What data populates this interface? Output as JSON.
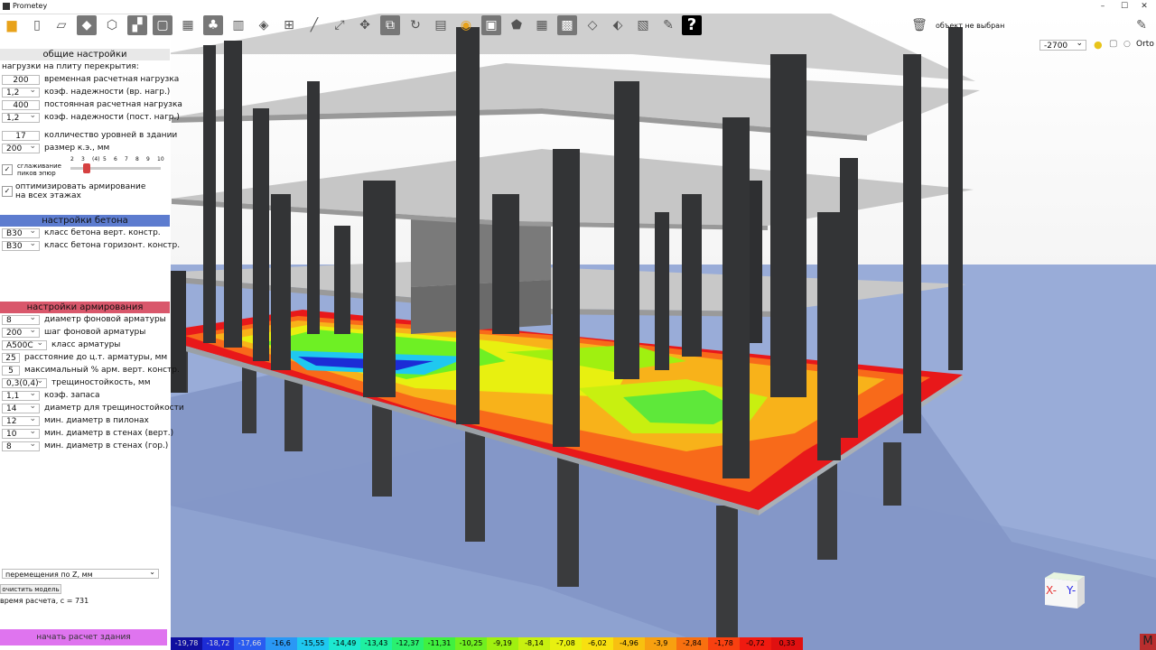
{
  "window": {
    "title": "Prometey",
    "minimize": "–",
    "maximize": "☐",
    "close": "✕"
  },
  "toolbar": {
    "help_label": "?",
    "object_status": "объект не выбран",
    "level_value": "-2700",
    "ortho_label": "Orto"
  },
  "general": {
    "header": "общие настройки",
    "loads_label": "нагрузки на плиту перекрытия:",
    "temp_load_value": "200",
    "temp_load_label": "временная расчетная нагрузка",
    "temp_coef_value": "1,2",
    "temp_coef_label": "коэф. надежности (вр. нагр.)",
    "perm_load_value": "400",
    "perm_load_label": "постоянная расчетная нагрузка",
    "perm_coef_value": "1,2",
    "perm_coef_label": "коэф. надежности (пост. нагр.)",
    "levels_value": "17",
    "levels_label": "колличество уровней в здании",
    "mesh_value": "200",
    "mesh_label": "размер к.э., мм",
    "smoothing_label_1": "сглаживание",
    "smoothing_label_2": "пиков эпюр",
    "slider_ticks": [
      "2",
      "3",
      "(4)",
      "5",
      "6",
      "7",
      "8",
      "9",
      "10"
    ],
    "smoothing_level": 0.18,
    "optimize_label_1": "оптимизировать армирование",
    "optimize_label_2": "на всех этажах"
  },
  "concrete": {
    "header": "настройки бетона",
    "vert_value": "B30",
    "vert_label": "класс бетона верт. констр.",
    "horiz_value": "B30",
    "horiz_label": "класс бетона горизонт. констр."
  },
  "reinforcement": {
    "header": "настройки армирования",
    "bg_dia_value": "8",
    "bg_dia_label": "диаметр фоновой арматуры",
    "bg_step_value": "200",
    "bg_step_label": "шаг фоновой арматуры",
    "class_value": "A500C",
    "class_label": "класс арматуры",
    "cover_value": "25",
    "cover_label": "расстояние до ц.т. арматуры, мм",
    "max_pct_value": "5",
    "max_pct_label": "максимальный % арм. верт. констр.",
    "crack_value": "0,3(0,4)",
    "crack_label": "трещиностойкость, мм",
    "reserve_value": "1,1",
    "reserve_label": "коэф. запаса",
    "crack_dia_value": "14",
    "crack_dia_label": "диаметр для трещиностойкости",
    "pylon_value": "12",
    "pylon_label": "мин. диаметр в пилонах",
    "wall_v_value": "10",
    "wall_v_label": "мин. диаметр в стенах (верт.)",
    "wall_h_value": "8",
    "wall_h_label": "мин. диаметр в стенах (гор.)"
  },
  "bottom": {
    "result_select": "перемещения по Z, мм",
    "clear_button": "очистить модель",
    "calc_time": "время расчета, с = 731",
    "start_button": "начать расчет здания"
  },
  "legend": {
    "values": [
      "-19,78",
      "-18,72",
      "-17,66",
      "-16,6",
      "-15,55",
      "-14,49",
      "-13,43",
      "-12,37",
      "-11,31",
      "-10,25",
      "-9,19",
      "-8,14",
      "-7,08",
      "-6,02",
      "-4,96",
      "-3,9",
      "-2,84",
      "-1,78",
      "-0,72",
      "0,33"
    ],
    "colors": [
      "#1010a0",
      "#1c2cd6",
      "#2a5cf0",
      "#2a98f5",
      "#1fc8f0",
      "#1de8d0",
      "#1ff0a0",
      "#2af070",
      "#40f040",
      "#70f020",
      "#a0f010",
      "#c8f010",
      "#e8f010",
      "#f8e010",
      "#f8c010",
      "#f8a010",
      "#f87010",
      "#f84010",
      "#f01a10",
      "#e01010"
    ]
  },
  "axis_cube": {
    "x_label": "X-",
    "y_label": "Y-"
  },
  "corner_button": "M"
}
